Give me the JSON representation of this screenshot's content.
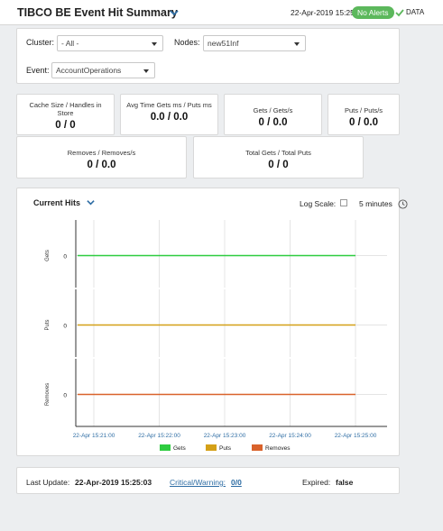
{
  "header": {
    "title": "TIBCO BE Event Hit Summary",
    "timestamp": "22-Apr-2019 15:25",
    "alert_badge": "No Alerts",
    "data_label": "DATA",
    "badge_color": "#5cb85c"
  },
  "filters": {
    "cluster_label": "Cluster:",
    "cluster_value": "- All -",
    "nodes_label": "Nodes:",
    "nodes_value": "new51Inf",
    "event_label": "Event:",
    "event_value": "AccountOperations"
  },
  "kpis": [
    {
      "label": "Cache Size / Handles in Store",
      "value": "0 / 0"
    },
    {
      "label": "Avg Time Gets ms / Puts ms",
      "value": "0.0 / 0.0"
    },
    {
      "label": "Gets / Gets/s",
      "value": "0 / 0.0"
    },
    {
      "label": "Puts / Puts/s",
      "value": "0 / 0.0"
    },
    {
      "label": "Removes / Removes/s",
      "value": "0 / 0.0"
    },
    {
      "label": "Total Gets / Total Puts",
      "value": "0 / 0"
    }
  ],
  "chart_panel": {
    "title": "Current Hits",
    "log_scale_label": "Log Scale:",
    "log_scale_checked": false,
    "time_range": "5 minutes"
  },
  "chart_data": {
    "type": "line",
    "x": [
      "22-Apr 15:21:00",
      "22-Apr 15:22:00",
      "22-Apr 15:23:00",
      "22-Apr 15:24:00",
      "22-Apr 15:25:00"
    ],
    "series": [
      {
        "name": "Gets",
        "ylabel": "Gets",
        "ytick": "0",
        "values": [
          0,
          0,
          0,
          0,
          0
        ],
        "color": "#2ecc40"
      },
      {
        "name": "Puts",
        "ylabel": "Puts",
        "ytick": "0",
        "values": [
          0,
          0,
          0,
          0,
          0
        ],
        "color": "#d4a017"
      },
      {
        "name": "Removes",
        "ylabel": "Removes",
        "ytick": "0",
        "values": [
          0,
          0,
          0,
          0,
          0
        ],
        "color": "#d9622b"
      }
    ],
    "grid": true,
    "legend": "bottom"
  },
  "footer": {
    "last_update_label": "Last Update:",
    "last_update_value": "22-Apr-2019 15:25:03",
    "cw_label": "Critical/Warning:",
    "cw_value": "0/0",
    "expired_label": "Expired:",
    "expired_value": "false"
  }
}
